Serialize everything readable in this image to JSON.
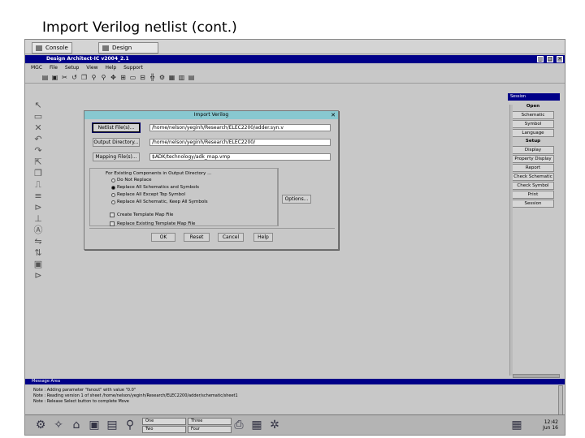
{
  "slide": {
    "title": "Import Verilog netlist (cont.)"
  },
  "top_tabs": [
    "Console",
    "Design Architect..."
  ],
  "app": {
    "title": "Design Architect-IC v2004_2.1"
  },
  "menus": [
    "MGC",
    "File",
    "Setup",
    "View",
    "Help",
    "Support"
  ],
  "right_panel": {
    "title": "Session",
    "items": [
      {
        "kind": "head",
        "label": "Open"
      },
      {
        "kind": "button",
        "label": "Schematic"
      },
      {
        "kind": "button",
        "label": "Symbol"
      },
      {
        "kind": "button",
        "label": "Language"
      },
      {
        "kind": "head",
        "label": "Setup"
      },
      {
        "kind": "button",
        "label": "Display"
      },
      {
        "kind": "button",
        "label": "Property Display"
      },
      {
        "kind": "button",
        "label": "Report"
      },
      {
        "kind": "button",
        "label": "Check Schematic"
      },
      {
        "kind": "button",
        "label": "Check Symbol"
      },
      {
        "kind": "button",
        "label": "Print"
      },
      {
        "kind": "button",
        "label": "Session"
      }
    ]
  },
  "dialog": {
    "title": "Import Verilog",
    "netlist_button": "Netlist File(s)...",
    "netlist_value": "/home/nelson/yeginh/Research/ELEC2200/adder.syn.v",
    "output_button": "Output Directory...",
    "output_value": "/home/nelson/yeginh/Research/ELEC2200/",
    "mapping_button": "Mapping File(s)...",
    "mapping_value": "$ADK/technology/adk_map.vmp",
    "group_label": "For Existing Components in Output Directory ...",
    "options": [
      {
        "label": "Do Not Replace",
        "selected": false
      },
      {
        "label": "Replace All Schematics and Symbols",
        "selected": true
      },
      {
        "label": "Replace All Except Top Symbol",
        "selected": false
      },
      {
        "label": "Replace All Schematic, Keep All Symbols",
        "selected": false
      }
    ],
    "options_button": "Options...",
    "checkbox_1": "Create Template Map File",
    "checkbox_2": "Replace Existing Template Map File",
    "ok": "OK",
    "reset": "Reset",
    "cancel": "Cancel",
    "help": "Help"
  },
  "message_area": {
    "title": "Message Area",
    "lines": [
      "Note : Adding parameter \"fanout\" with value \"0.0\"",
      "Note : Reading version 1 of sheet /home/nelson/yeginh/Research/ELEC2200/adder/schematic/sheet1",
      "Note : Release Select button to complete Move"
    ]
  },
  "taskbar": {
    "desk_1": "One",
    "desk_2": "Two",
    "desk_3": "Three",
    "desk_4": "Four",
    "time": "12:42",
    "date": "Jun 16"
  }
}
